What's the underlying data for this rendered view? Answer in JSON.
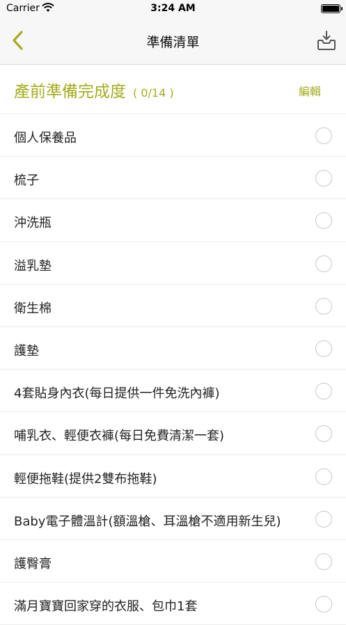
{
  "status": {
    "carrier": "Carrier",
    "time": "3:24 AM"
  },
  "nav": {
    "title": "準備清單"
  },
  "progress": {
    "label": "產前準備完成度",
    "count": "( 0/14 )",
    "edit": "編輯"
  },
  "items": [
    {
      "label": "個人保養品",
      "checked": false
    },
    {
      "label": "梳子",
      "checked": false
    },
    {
      "label": "沖洗瓶",
      "checked": false
    },
    {
      "label": "溢乳墊",
      "checked": false
    },
    {
      "label": "衛生棉",
      "checked": false
    },
    {
      "label": "護墊",
      "checked": false
    },
    {
      "label": "4套貼身內衣(每日提供一件免洗內褲)",
      "checked": false
    },
    {
      "label": "哺乳衣、輕便衣褲(每日免費清潔一套)",
      "checked": false
    },
    {
      "label": "輕便拖鞋(提供2雙布拖鞋)",
      "checked": false
    },
    {
      "label": "Baby電子體溫計(額溫槍、耳溫槍不適用新生兒)",
      "checked": false
    },
    {
      "label": "護臀膏",
      "checked": false
    },
    {
      "label": "滿月寶寶回家穿的衣服、包巾1套",
      "checked": false
    }
  ],
  "colors": {
    "accent": "#a3ad1c"
  }
}
